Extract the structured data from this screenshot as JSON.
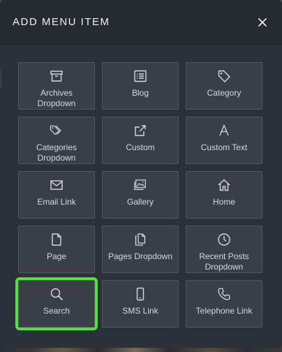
{
  "dialog": {
    "title": "ADD MENU ITEM",
    "close_icon": "close-icon"
  },
  "items": [
    {
      "label": "Archives\nDropdown",
      "icon": "archive-box-icon"
    },
    {
      "label": "Blog",
      "icon": "list-icon"
    },
    {
      "label": "Category",
      "icon": "tag-icon"
    },
    {
      "label": "Categories\nDropdown",
      "icon": "tags-icon"
    },
    {
      "label": "Custom",
      "icon": "external-link-icon"
    },
    {
      "label": "Custom Text",
      "icon": "letter-a-icon"
    },
    {
      "label": "Email Link",
      "icon": "envelope-icon"
    },
    {
      "label": "Gallery",
      "icon": "images-icon"
    },
    {
      "label": "Home",
      "icon": "home-icon"
    },
    {
      "label": "Page",
      "icon": "page-icon"
    },
    {
      "label": "Pages Dropdown",
      "icon": "pages-icon"
    },
    {
      "label": "Recent Posts\nDropdown",
      "icon": "clock-icon"
    },
    {
      "label": "Search",
      "icon": "magnifier-icon"
    },
    {
      "label": "SMS Link",
      "icon": "phone-mobile-icon"
    },
    {
      "label": "Telephone Link",
      "icon": "telephone-icon"
    }
  ],
  "highlight_color": "#52e33a",
  "highlighted_item": "Search"
}
